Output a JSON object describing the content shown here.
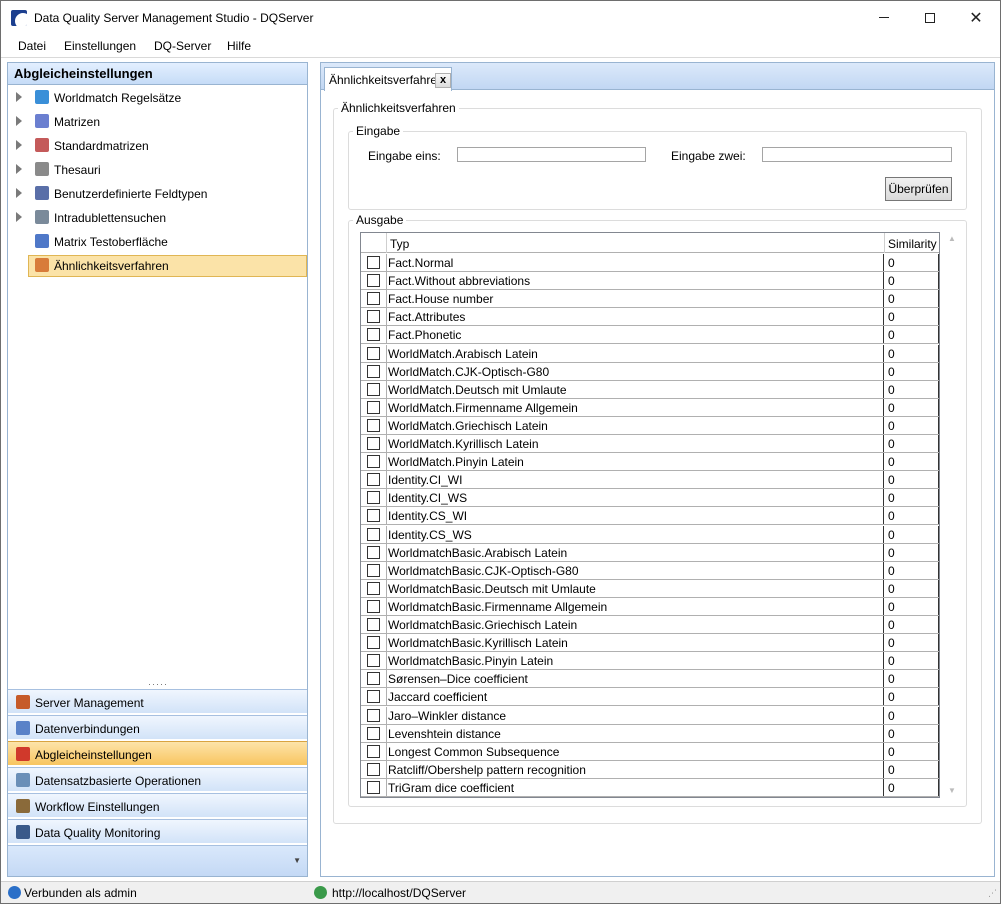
{
  "window": {
    "title": "Data Quality Server Management Studio - DQServer",
    "min_glyph": "",
    "close_glyph": "✕"
  },
  "menu": [
    "Datei",
    "Einstellungen",
    "DQ-Server",
    "Hilfe"
  ],
  "left_panel": {
    "header": "Abgleicheinstellungen",
    "tree": [
      {
        "label": "Worldmatch Regelsätze",
        "expandable": true,
        "icon": "globe-icon",
        "color": "#3a8fd8"
      },
      {
        "label": "Matrizen",
        "expandable": true,
        "icon": "matrix-icon",
        "color": "#6b7fd0"
      },
      {
        "label": "Standardmatrizen",
        "expandable": true,
        "icon": "standard-matrix-icon",
        "color": "#c45a5a"
      },
      {
        "label": "Thesauri",
        "expandable": true,
        "icon": "book-icon",
        "color": "#8a8a8a"
      },
      {
        "label": "Benutzerdefinierte Feldtypen",
        "expandable": true,
        "icon": "field-type-icon",
        "color": "#5a6fa8"
      },
      {
        "label": "Intradublettensuchen",
        "expandable": true,
        "icon": "magnifier-icon",
        "color": "#7a8a9a"
      },
      {
        "label": "Matrix Testoberfläche",
        "expandable": false,
        "icon": "gears-icon",
        "color": "#4f78c8"
      },
      {
        "label": "Ähnlichkeitsverfahren",
        "expandable": false,
        "icon": "checklist-icon",
        "color": "#d87c3a",
        "selected": true
      }
    ],
    "splitter": "·····",
    "nav": [
      {
        "label": "Server Management",
        "icon": "wrench-icon",
        "color": "#c65b2a"
      },
      {
        "label": "Datenverbindungen",
        "icon": "database-icon",
        "color": "#5a82c8"
      },
      {
        "label": "Abgleicheinstellungen",
        "icon": "match-settings-icon",
        "color": "#d0392b",
        "active": true
      },
      {
        "label": "Datensatzbasierte Operationen",
        "icon": "records-icon",
        "color": "#6a8fb8"
      },
      {
        "label": "Workflow Einstellungen",
        "icon": "box-icon",
        "color": "#8a6a3a"
      },
      {
        "label": "Data Quality Monitoring",
        "icon": "monitor-icon",
        "color": "#3a5a8a"
      }
    ],
    "footer_chevron": "▼"
  },
  "tab": {
    "label": "Ähnlichkeitsverfahren",
    "close": "x"
  },
  "form": {
    "outer_legend": "Ähnlichkeitsverfahren",
    "input_legend": "Eingabe",
    "label_one": "Eingabe eins:",
    "label_two": "Eingabe zwei:",
    "value_one": "",
    "value_two": "",
    "check_button": "Überprüfen",
    "output_legend": "Ausgabe"
  },
  "grid": {
    "columns": [
      "",
      "Typ",
      "Similarity"
    ],
    "rows": [
      {
        "typ": "Fact.Normal",
        "sim": "0"
      },
      {
        "typ": "Fact.Without abbreviations",
        "sim": "0"
      },
      {
        "typ": "Fact.House number",
        "sim": "0"
      },
      {
        "typ": "Fact.Attributes",
        "sim": "0"
      },
      {
        "typ": "Fact.Phonetic",
        "sim": "0"
      },
      {
        "typ": "WorldMatch.Arabisch Latein",
        "sim": "0"
      },
      {
        "typ": "WorldMatch.CJK-Optisch-G80",
        "sim": "0"
      },
      {
        "typ": "WorldMatch.Deutsch mit Umlaute",
        "sim": "0"
      },
      {
        "typ": "WorldMatch.Firmenname Allgemein",
        "sim": "0"
      },
      {
        "typ": "WorldMatch.Griechisch Latein",
        "sim": "0"
      },
      {
        "typ": "WorldMatch.Kyrillisch Latein",
        "sim": "0"
      },
      {
        "typ": "WorldMatch.Pinyin Latein",
        "sim": "0"
      },
      {
        "typ": "Identity.CI_WI",
        "sim": "0"
      },
      {
        "typ": "Identity.CI_WS",
        "sim": "0"
      },
      {
        "typ": "Identity.CS_WI",
        "sim": "0"
      },
      {
        "typ": "Identity.CS_WS",
        "sim": "0"
      },
      {
        "typ": "WorldmatchBasic.Arabisch Latein",
        "sim": "0"
      },
      {
        "typ": "WorldmatchBasic.CJK-Optisch-G80",
        "sim": "0"
      },
      {
        "typ": "WorldmatchBasic.Deutsch mit Umlaute",
        "sim": "0"
      },
      {
        "typ": "WorldmatchBasic.Firmenname Allgemein",
        "sim": "0"
      },
      {
        "typ": "WorldmatchBasic.Griechisch Latein",
        "sim": "0"
      },
      {
        "typ": "WorldmatchBasic.Kyrillisch Latein",
        "sim": "0"
      },
      {
        "typ": "WorldmatchBasic.Pinyin Latein",
        "sim": "0"
      },
      {
        "typ": "Sørensen–Dice coefficient",
        "sim": "0"
      },
      {
        "typ": "Jaccard coefficient",
        "sim": "0"
      },
      {
        "typ": "Jaro–Winkler distance",
        "sim": "0"
      },
      {
        "typ": "Levenshtein distance",
        "sim": "0"
      },
      {
        "typ": "Longest Common Subsequence",
        "sim": "0"
      },
      {
        "typ": "Ratcliff/Obershelp pattern recognition",
        "sim": "0"
      },
      {
        "typ": "TriGram dice coefficient",
        "sim": "0"
      }
    ],
    "scroll_up": "▲",
    "scroll_down": "▼"
  },
  "status": {
    "connected": "Verbunden als admin",
    "url": "http://localhost/DQServer",
    "grip": "⋰"
  }
}
